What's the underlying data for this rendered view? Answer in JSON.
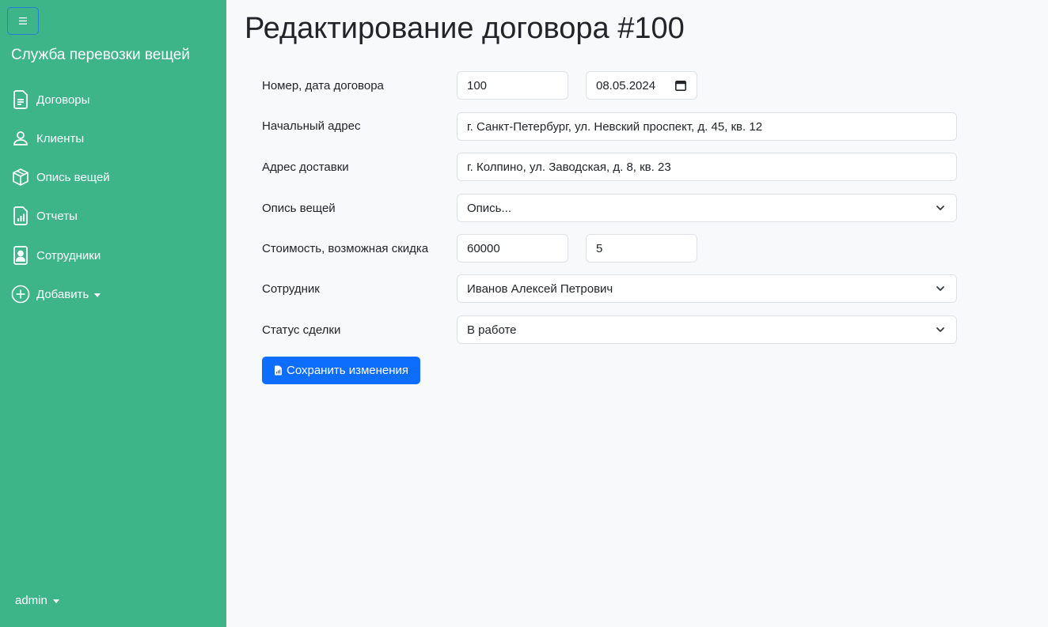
{
  "sidebar": {
    "brand": "Служба перевозки вещей",
    "toggle_icon": "hamburger-icon",
    "items": [
      {
        "label": "Договоры",
        "icon": "file-text-icon"
      },
      {
        "label": "Клиенты",
        "icon": "person-icon"
      },
      {
        "label": "Опись вещей",
        "icon": "box-icon"
      },
      {
        "label": "Отчеты",
        "icon": "file-chart-icon"
      },
      {
        "label": "Сотрудники",
        "icon": "person-badge-icon"
      },
      {
        "label": "Добавить",
        "icon": "plus-circle-icon"
      }
    ],
    "user": "admin"
  },
  "main": {
    "title": "Редактирование договора #100",
    "form": {
      "number_date_label": "Номер, дата договора",
      "number_value": "100",
      "date_value": "08.05.2024",
      "start_address_label": "Начальный адрес",
      "start_address_value": "г. Санкт-Петербург, ул. Невский проспект, д. 45, кв. 12",
      "delivery_address_label": "Адрес доставки",
      "delivery_address_value": "г. Колпино, ул. Заводская, д. 8, кв. 23",
      "inventory_label": "Опись вещей",
      "inventory_value": "Опись...",
      "cost_discount_label": "Стоимость, возможная скидка",
      "cost_value": "60000",
      "discount_value": "5",
      "employee_label": "Сотрудник",
      "employee_value": "Иванов Алексей Петрович",
      "status_label": "Статус сделки",
      "status_value": "В работе"
    },
    "save_label": "Сохранить изменения"
  },
  "colors": {
    "sidebar_bg": "#3eb489",
    "primary": "#0d6efd",
    "page_bg": "#f8f9fa"
  }
}
